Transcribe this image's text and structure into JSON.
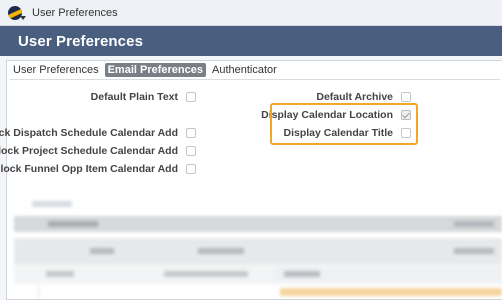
{
  "window": {
    "title": "User Preferences",
    "logo_icon": "app-logo-icon"
  },
  "header": {
    "title": "User Preferences",
    "background_color": "#4a5f80"
  },
  "tabs": [
    {
      "label": "User Preferences",
      "active": false
    },
    {
      "label": "Email Preferences",
      "active": true
    },
    {
      "label": "Authenticator",
      "active": false
    }
  ],
  "fields": {
    "default_plain_text": {
      "label": "Default Plain Text",
      "checked": false
    },
    "block_dispatch_schedule_calendar_add": {
      "label": "Block Dispatch Schedule Calendar Add",
      "checked": false
    },
    "block_project_schedule_calendar_add": {
      "label": "Block Project Schedule Calendar Add",
      "checked": false
    },
    "block_funnel_opp_item_calendar_add": {
      "label": "Block Funnel Opp Item Calendar Add",
      "checked": false
    },
    "default_archive": {
      "label": "Default Archive",
      "checked": false
    },
    "display_calendar_location": {
      "label": "Display Calendar Location",
      "checked": true
    },
    "display_calendar_title": {
      "label": "Display Calendar Title",
      "checked": false
    }
  },
  "highlight_color": "#f0a626"
}
